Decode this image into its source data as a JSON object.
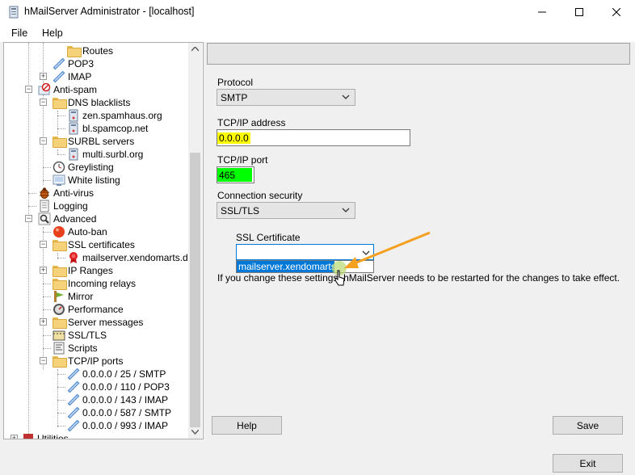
{
  "window": {
    "title": "hMailServer Administrator - [localhost]"
  },
  "menu": {
    "items": [
      "File",
      "Help"
    ]
  },
  "tree": {
    "items": [
      {
        "label": "Routes",
        "icon": "folder-icon"
      },
      {
        "label": "POP3",
        "icon": "protocol-icon"
      },
      {
        "label": "IMAP",
        "icon": "protocol-icon"
      },
      {
        "label": "Anti-spam",
        "icon": "anti-spam-icon"
      },
      {
        "label": "DNS blacklists",
        "icon": "folder-icon"
      },
      {
        "label": "zen.spamhaus.org",
        "icon": "server-icon"
      },
      {
        "label": "bl.spamcop.net",
        "icon": "server-icon"
      },
      {
        "label": "SURBL servers",
        "icon": "folder-icon"
      },
      {
        "label": "multi.surbl.org",
        "icon": "server-icon"
      },
      {
        "label": "Greylisting",
        "icon": "clock-icon"
      },
      {
        "label": "White listing",
        "icon": "whitelist-icon"
      },
      {
        "label": "Anti-virus",
        "icon": "bug-icon"
      },
      {
        "label": "Logging",
        "icon": "log-icon"
      },
      {
        "label": "Advanced",
        "icon": "magnifier-icon"
      },
      {
        "label": "Auto-ban",
        "icon": "red-dot-icon"
      },
      {
        "label": "SSL certificates",
        "icon": "folder-icon"
      },
      {
        "label": "mailserver.xendomarts.de",
        "icon": "certificate-icon"
      },
      {
        "label": "IP Ranges",
        "icon": "folder-icon"
      },
      {
        "label": "Incoming relays",
        "icon": "folder-icon"
      },
      {
        "label": "Mirror",
        "icon": "mirror-icon"
      },
      {
        "label": "Performance",
        "icon": "gauge-icon"
      },
      {
        "label": "Server messages",
        "icon": "folder-icon"
      },
      {
        "label": "SSL/TLS",
        "icon": "ssl-icon"
      },
      {
        "label": "Scripts",
        "icon": "script-icon"
      },
      {
        "label": "TCP/IP ports",
        "icon": "folder-icon"
      },
      {
        "label": "0.0.0.0 / 25 / SMTP",
        "icon": "port-icon"
      },
      {
        "label": "0.0.0.0 / 110 / POP3",
        "icon": "port-icon"
      },
      {
        "label": "0.0.0.0 / 143 / IMAP",
        "icon": "port-icon"
      },
      {
        "label": "0.0.0.0 / 587 / SMTP",
        "icon": "port-icon"
      },
      {
        "label": "0.0.0.0 / 993 / IMAP",
        "icon": "port-icon"
      },
      {
        "label": "Utilities",
        "icon": "tools-icon"
      }
    ]
  },
  "form": {
    "protocol_label": "Protocol",
    "protocol_value": "SMTP",
    "address_label": "TCP/IP address",
    "address_value": "0.0.0.0",
    "port_label": "TCP/IP port",
    "port_value": "465",
    "security_label": "Connection security",
    "security_value": "SSL/TLS",
    "ssl_cert_label": "SSL Certificate",
    "ssl_cert_value": "",
    "ssl_cert_options": [
      "mailserver.xendomarts.de"
    ],
    "restart_notice": "If you change these settings, hMailServer needs to be restarted for the changes to take effect."
  },
  "buttons": {
    "help": "Help",
    "save": "Save",
    "exit": "Exit"
  },
  "colors": {
    "highlight_yellow": "#ffff00",
    "highlight_green": "#00ff00",
    "selection_blue": "#0078d7",
    "arrow_orange": "#f5a020"
  }
}
